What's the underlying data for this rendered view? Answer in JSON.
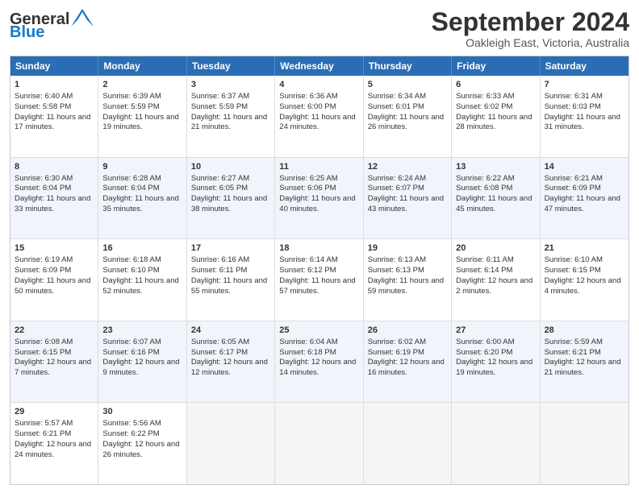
{
  "logo": {
    "general": "General",
    "blue": "Blue"
  },
  "title": "September 2024",
  "location": "Oakleigh East, Victoria, Australia",
  "days": [
    "Sunday",
    "Monday",
    "Tuesday",
    "Wednesday",
    "Thursday",
    "Friday",
    "Saturday"
  ],
  "weeks": [
    [
      {
        "day": "1",
        "sunrise": "Sunrise: 6:40 AM",
        "sunset": "Sunset: 5:58 PM",
        "daylight": "Daylight: 11 hours and 17 minutes."
      },
      {
        "day": "2",
        "sunrise": "Sunrise: 6:39 AM",
        "sunset": "Sunset: 5:59 PM",
        "daylight": "Daylight: 11 hours and 19 minutes."
      },
      {
        "day": "3",
        "sunrise": "Sunrise: 6:37 AM",
        "sunset": "Sunset: 5:59 PM",
        "daylight": "Daylight: 11 hours and 21 minutes."
      },
      {
        "day": "4",
        "sunrise": "Sunrise: 6:36 AM",
        "sunset": "Sunset: 6:00 PM",
        "daylight": "Daylight: 11 hours and 24 minutes."
      },
      {
        "day": "5",
        "sunrise": "Sunrise: 6:34 AM",
        "sunset": "Sunset: 6:01 PM",
        "daylight": "Daylight: 11 hours and 26 minutes."
      },
      {
        "day": "6",
        "sunrise": "Sunrise: 6:33 AM",
        "sunset": "Sunset: 6:02 PM",
        "daylight": "Daylight: 11 hours and 28 minutes."
      },
      {
        "day": "7",
        "sunrise": "Sunrise: 6:31 AM",
        "sunset": "Sunset: 6:03 PM",
        "daylight": "Daylight: 11 hours and 31 minutes."
      }
    ],
    [
      {
        "day": "8",
        "sunrise": "Sunrise: 6:30 AM",
        "sunset": "Sunset: 6:04 PM",
        "daylight": "Daylight: 11 hours and 33 minutes."
      },
      {
        "day": "9",
        "sunrise": "Sunrise: 6:28 AM",
        "sunset": "Sunset: 6:04 PM",
        "daylight": "Daylight: 11 hours and 35 minutes."
      },
      {
        "day": "10",
        "sunrise": "Sunrise: 6:27 AM",
        "sunset": "Sunset: 6:05 PM",
        "daylight": "Daylight: 11 hours and 38 minutes."
      },
      {
        "day": "11",
        "sunrise": "Sunrise: 6:25 AM",
        "sunset": "Sunset: 6:06 PM",
        "daylight": "Daylight: 11 hours and 40 minutes."
      },
      {
        "day": "12",
        "sunrise": "Sunrise: 6:24 AM",
        "sunset": "Sunset: 6:07 PM",
        "daylight": "Daylight: 11 hours and 43 minutes."
      },
      {
        "day": "13",
        "sunrise": "Sunrise: 6:22 AM",
        "sunset": "Sunset: 6:08 PM",
        "daylight": "Daylight: 11 hours and 45 minutes."
      },
      {
        "day": "14",
        "sunrise": "Sunrise: 6:21 AM",
        "sunset": "Sunset: 6:09 PM",
        "daylight": "Daylight: 11 hours and 47 minutes."
      }
    ],
    [
      {
        "day": "15",
        "sunrise": "Sunrise: 6:19 AM",
        "sunset": "Sunset: 6:09 PM",
        "daylight": "Daylight: 11 hours and 50 minutes."
      },
      {
        "day": "16",
        "sunrise": "Sunrise: 6:18 AM",
        "sunset": "Sunset: 6:10 PM",
        "daylight": "Daylight: 11 hours and 52 minutes."
      },
      {
        "day": "17",
        "sunrise": "Sunrise: 6:16 AM",
        "sunset": "Sunset: 6:11 PM",
        "daylight": "Daylight: 11 hours and 55 minutes."
      },
      {
        "day": "18",
        "sunrise": "Sunrise: 6:14 AM",
        "sunset": "Sunset: 6:12 PM",
        "daylight": "Daylight: 11 hours and 57 minutes."
      },
      {
        "day": "19",
        "sunrise": "Sunrise: 6:13 AM",
        "sunset": "Sunset: 6:13 PM",
        "daylight": "Daylight: 11 hours and 59 minutes."
      },
      {
        "day": "20",
        "sunrise": "Sunrise: 6:11 AM",
        "sunset": "Sunset: 6:14 PM",
        "daylight": "Daylight: 12 hours and 2 minutes."
      },
      {
        "day": "21",
        "sunrise": "Sunrise: 6:10 AM",
        "sunset": "Sunset: 6:15 PM",
        "daylight": "Daylight: 12 hours and 4 minutes."
      }
    ],
    [
      {
        "day": "22",
        "sunrise": "Sunrise: 6:08 AM",
        "sunset": "Sunset: 6:15 PM",
        "daylight": "Daylight: 12 hours and 7 minutes."
      },
      {
        "day": "23",
        "sunrise": "Sunrise: 6:07 AM",
        "sunset": "Sunset: 6:16 PM",
        "daylight": "Daylight: 12 hours and 9 minutes."
      },
      {
        "day": "24",
        "sunrise": "Sunrise: 6:05 AM",
        "sunset": "Sunset: 6:17 PM",
        "daylight": "Daylight: 12 hours and 12 minutes."
      },
      {
        "day": "25",
        "sunrise": "Sunrise: 6:04 AM",
        "sunset": "Sunset: 6:18 PM",
        "daylight": "Daylight: 12 hours and 14 minutes."
      },
      {
        "day": "26",
        "sunrise": "Sunrise: 6:02 AM",
        "sunset": "Sunset: 6:19 PM",
        "daylight": "Daylight: 12 hours and 16 minutes."
      },
      {
        "day": "27",
        "sunrise": "Sunrise: 6:00 AM",
        "sunset": "Sunset: 6:20 PM",
        "daylight": "Daylight: 12 hours and 19 minutes."
      },
      {
        "day": "28",
        "sunrise": "Sunrise: 5:59 AM",
        "sunset": "Sunset: 6:21 PM",
        "daylight": "Daylight: 12 hours and 21 minutes."
      }
    ],
    [
      {
        "day": "29",
        "sunrise": "Sunrise: 5:57 AM",
        "sunset": "Sunset: 6:21 PM",
        "daylight": "Daylight: 12 hours and 24 minutes."
      },
      {
        "day": "30",
        "sunrise": "Sunrise: 5:56 AM",
        "sunset": "Sunset: 6:22 PM",
        "daylight": "Daylight: 12 hours and 26 minutes."
      },
      null,
      null,
      null,
      null,
      null
    ]
  ]
}
